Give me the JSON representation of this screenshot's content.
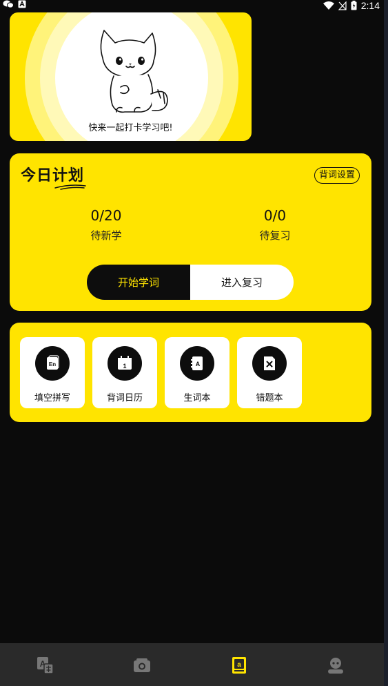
{
  "status_bar": {
    "time": "2:14",
    "icons": [
      "wechat-icon",
      "text-icon",
      "wifi-icon",
      "no-sim-icon",
      "battery-icon"
    ]
  },
  "hero": {
    "caption": "快来一起打卡学习吧!"
  },
  "plan": {
    "title": "今日计划",
    "settings_label": "背词设置",
    "new": {
      "value": "0/20",
      "label": "待新学"
    },
    "review": {
      "value": "0/0",
      "label": "待复习"
    },
    "start_label": "开始学词",
    "review_label": "进入复习"
  },
  "tools": [
    {
      "label": "填空拼写",
      "icon": "en-card-icon"
    },
    {
      "label": "背词日历",
      "icon": "calendar-icon"
    },
    {
      "label": "生词本",
      "icon": "notebook-icon"
    },
    {
      "label": "错题本",
      "icon": "wrong-doc-icon"
    }
  ],
  "bottom_nav": [
    "translate-icon",
    "camera-icon",
    "wordbook-icon",
    "profile-icon"
  ],
  "colors": {
    "accent": "#ffe400",
    "background": "#0b0b0b",
    "nav_bg": "#2a2a2a",
    "nav_active": "#ffe400",
    "nav_inactive": "#777777"
  }
}
